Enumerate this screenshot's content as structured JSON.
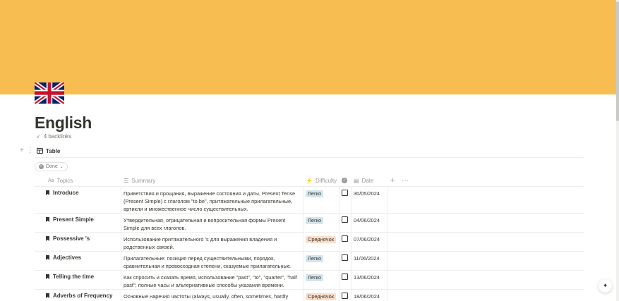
{
  "page": {
    "title": "English",
    "backlinks": "4 backlinks"
  },
  "colors": {
    "cover": "#f8bd50",
    "badge_easy": "#d3e5ef",
    "badge_medium": "#fadec9"
  },
  "database": {
    "view_label": "Table",
    "filter_label": "Done",
    "columns": {
      "topics": "Topics",
      "summary": "Summary",
      "difficulty": "Difficulty",
      "date": "Date"
    },
    "rows": [
      {
        "topic": "Introduce",
        "summary": "Приветствия и прощания, выражение состояния и даты, Present Tense (Present Simple) с глаголом \"to be\", притяжательные прилагательные, артикли и множественное число существительных.",
        "difficulty": "Легко",
        "date": "30/05/2024"
      },
      {
        "topic": "Present Simple",
        "summary": "Утвердительная, отрицательная и вопросительная формы Present Simple для всех глаголов.",
        "difficulty": "Легко",
        "date": "04/06/2024"
      },
      {
        "topic": "Possessive 's",
        "summary": "Использование притяжательного 's для выражения владения и родственных связей.",
        "difficulty": "Среднячок",
        "date": "07/06/2024"
      },
      {
        "topic": "Adjectives",
        "summary": "Прилагательные: позиция перед существительными, порядок, сравнительная и превосходная степени, сказуемые прилагательные.",
        "difficulty": "Легко",
        "date": "11/06/2024"
      },
      {
        "topic": "Telling the time",
        "summary": "Как спросить и сказать время, использование \"past\", \"to\", \"quarter\", \"half past\"; полные часы и альтернативные способы указания времени.",
        "difficulty": "Легко",
        "date": "13/06/2024"
      },
      {
        "topic": "Adverbs of Frequency",
        "summary": "Основные наречия частоты (always, usually, often, sometimes, hardly ever,",
        "difficulty": "Среднячок",
        "date": "18/06/2024"
      }
    ]
  }
}
